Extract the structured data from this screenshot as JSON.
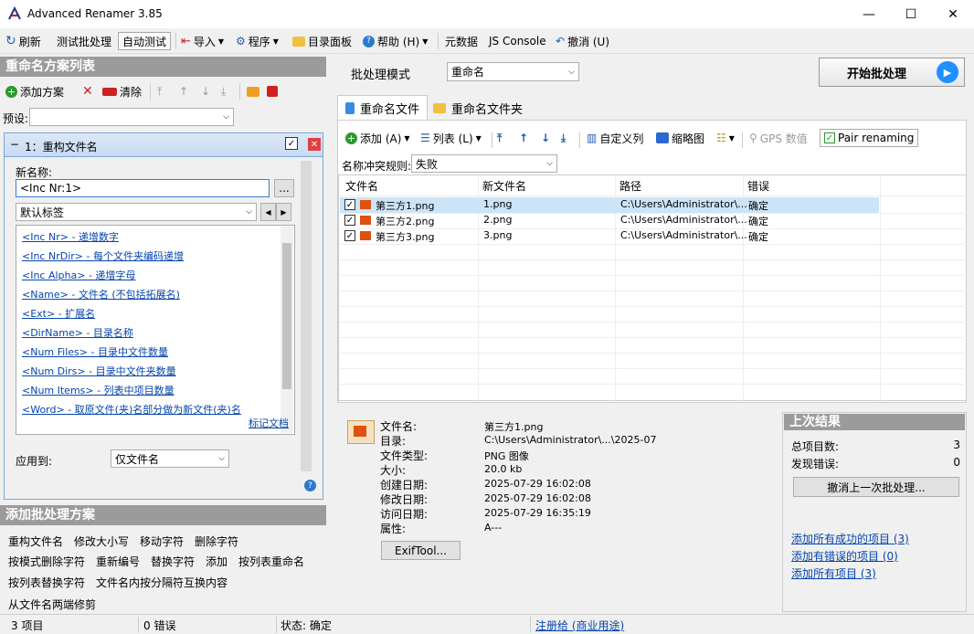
{
  "app": {
    "title": "Advanced Renamer 3.85"
  },
  "toolbar": {
    "refresh": "刷新",
    "test_batch": "测试批处理",
    "auto_test": "自动测试",
    "import": "导入",
    "program": "程序",
    "dir_panel": "目录面板",
    "help": "帮助 (H)",
    "metadata": "元数据",
    "js_console": "JS Console",
    "undo": "撤消 (U)"
  },
  "left": {
    "methods_title": "重命名方案列表",
    "add_method": "添加方案",
    "clear": "清除",
    "preset_label": "预设:",
    "method_header": "1：重构文件名",
    "new_name_label": "新名称:",
    "new_name_value": "<Inc Nr:1>",
    "ellipsis": "...",
    "tags_select": "默认标签",
    "tags": [
      "<Inc Nr> - 递增数字",
      "<Inc NrDir> - 每个文件夹编码递增",
      "<Inc Alpha> - 递增字母",
      "<Name> - 文件名 (不包括拓展名)",
      "<Ext> - 扩展名",
      "<DirName> - 目录名称",
      "<Num Files> - 目录中文件数量",
      "<Num Dirs> - 目录中文件夹数量",
      "<Num Items> - 列表中项目数量",
      "<Word> - 取原文件(夹)名部分做为新文件(夹)名"
    ],
    "tag_docs": "标记文档",
    "apply_label": "应用到:",
    "apply_value": "仅文件名"
  },
  "add_panel": {
    "title": "添加批处理方案",
    "items": [
      "重构文件名",
      "修改大小写",
      "移动字符",
      "删除字符",
      "按模式删除字符",
      "重新编号",
      "替换字符",
      "添加",
      "按列表重命名",
      "按列表替换字符",
      "文件名内按分隔符互换内容",
      "从文件名两端修剪"
    ]
  },
  "batch": {
    "mode_label": "批处理模式",
    "mode_value": "重命名",
    "start": "开始批处理"
  },
  "tabs": {
    "files": "重命名文件",
    "folders": "重命名文件夹"
  },
  "filebar": {
    "add": "添加 (A)",
    "list": "列表 (L)",
    "custom_cols": "自定义列",
    "thumbs": "缩略图",
    "gps": "GPS 数值",
    "pair": "Pair renaming"
  },
  "conflict": {
    "label": "名称冲突规则:",
    "value": "失败"
  },
  "grid": {
    "headers": [
      "文件名",
      "新文件名",
      "路径",
      "错误"
    ],
    "rows": [
      [
        "第三方1.png",
        "1.png",
        "C:\\Users\\Administrator\\...",
        "确定"
      ],
      [
        "第三方2.png",
        "2.png",
        "C:\\Users\\Administrator\\...",
        "确定"
      ],
      [
        "第三方3.png",
        "3.png",
        "C:\\Users\\Administrator\\...",
        "确定"
      ]
    ]
  },
  "info": {
    "keys": [
      "文件名:",
      "目录:",
      "文件类型:",
      "大小:",
      "创建日期:",
      "修改日期:",
      "访问日期:",
      "属性:"
    ],
    "values": [
      "第三方1.png",
      "C:\\Users\\Administrator\\...\\2025-07",
      "PNG 图像",
      "20.0 kb",
      "2025-07-29 16:02:08",
      "2025-07-29 16:02:08",
      "2025-07-29 16:35:19",
      "A---"
    ],
    "exif": "ExifTool..."
  },
  "last": {
    "title": "上次结果",
    "total_label": "总项目数:",
    "total": "3",
    "errors_label": "发现错误:",
    "errors": "0",
    "undo": "撤消上一次批处理...",
    "links": [
      "添加所有成功的项目 (3)",
      "添加有错误的项目 (0)",
      "添加所有项目 (3)"
    ]
  },
  "status": {
    "items": "3 项目",
    "errors": "0 错误",
    "state": "状态: 确定",
    "reg": "注册给 (商业用途)"
  },
  "colors": {
    "accent": "#1e90ff",
    "header": "#9b9b9b",
    "link": "#0645ad"
  }
}
